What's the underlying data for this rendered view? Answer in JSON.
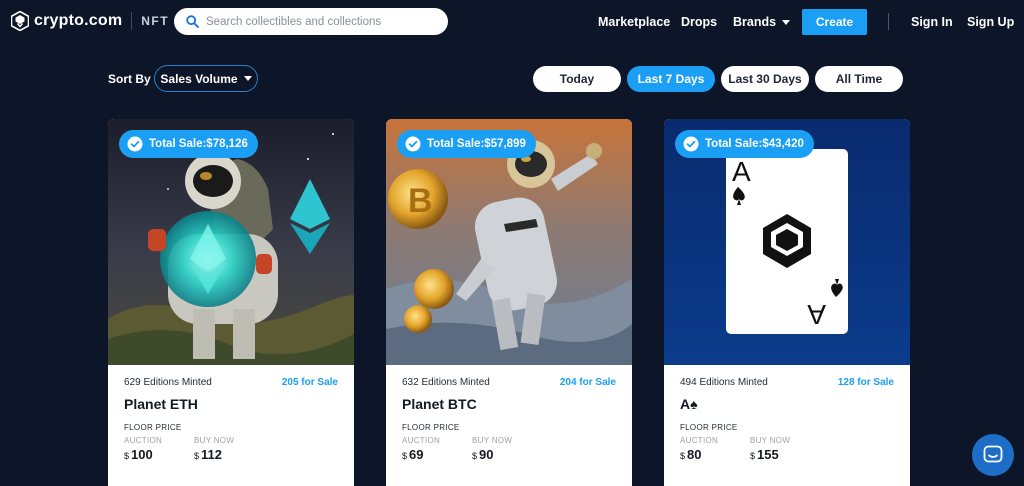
{
  "header": {
    "logo_text": "crypto.com",
    "logo_suffix": "NFT",
    "search_placeholder": "Search collectibles and collections",
    "nav": {
      "marketplace": "Marketplace",
      "drops": "Drops",
      "brands": "Brands",
      "create": "Create",
      "sign_in": "Sign In",
      "sign_up": "Sign Up"
    }
  },
  "sort": {
    "label": "Sort By",
    "selected": "Sales Volume"
  },
  "time_filters": [
    {
      "label": "Today",
      "active": false
    },
    {
      "label": "Last 7 Days",
      "active": true
    },
    {
      "label": "Last 30 Days",
      "active": false
    },
    {
      "label": "All Time",
      "active": false
    }
  ],
  "cards": [
    {
      "total_sale": "Total Sale:$78,126",
      "editions": "629 Editions Minted",
      "for_sale": "205 for Sale",
      "title": "Planet ETH",
      "floor_label": "FLOOR PRICE",
      "auction_label": "AUCTION",
      "buy_now_label": "BUY NOW",
      "currency": "$",
      "auction_price": "100",
      "buy_now_price": "112"
    },
    {
      "total_sale": "Total Sale:$57,899",
      "editions": "632 Editions Minted",
      "for_sale": "204 for Sale",
      "title": "Planet BTC",
      "floor_label": "FLOOR PRICE",
      "auction_label": "AUCTION",
      "buy_now_label": "BUY NOW",
      "currency": "$",
      "auction_price": "69",
      "buy_now_price": "90"
    },
    {
      "total_sale": "Total Sale:$43,420",
      "editions": "494 Editions Minted",
      "for_sale": "128 for Sale",
      "title": "A♠",
      "floor_label": "FLOOR PRICE",
      "auction_label": "AUCTION",
      "buy_now_label": "BUY NOW",
      "currency": "$",
      "auction_price": "80",
      "buy_now_price": "155",
      "card_rank": "A"
    }
  ],
  "colors": {
    "background": "#0c1628",
    "accent": "#1a9ff5",
    "chat_button": "#1e6ec8"
  },
  "icons": {
    "search": "search-icon",
    "verified": "verified-check-icon",
    "chat": "chat-icon",
    "brands_caret": "chevron-down-icon"
  }
}
